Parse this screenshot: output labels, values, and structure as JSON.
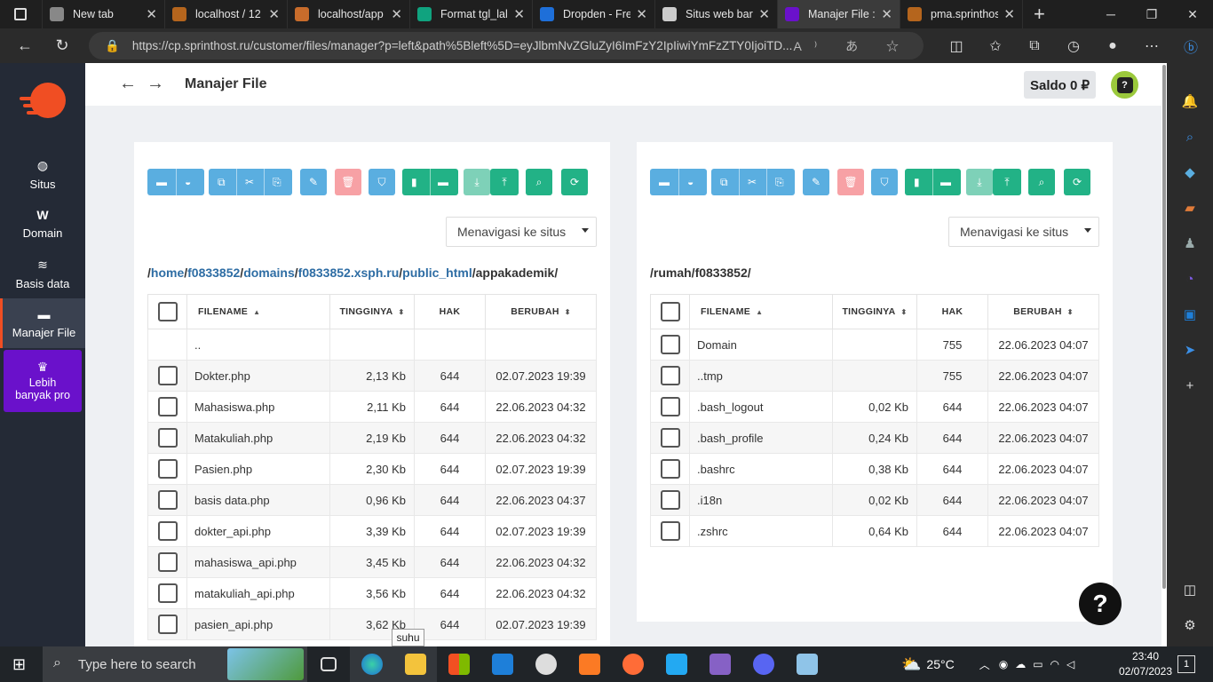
{
  "browser": {
    "tabs": [
      {
        "title": "New tab",
        "color": "#888"
      },
      {
        "title": "localhost / 12",
        "color": "#b5651d"
      },
      {
        "title": "localhost/app",
        "color": "#c86c2b"
      },
      {
        "title": "Format tgl_lal",
        "color": "#10a37f"
      },
      {
        "title": "Dropden - Fre",
        "color": "#1e6fd9"
      },
      {
        "title": "Situs web bar",
        "color": "#cccccc"
      },
      {
        "title": "Manajer File :",
        "color": "#6a11cb"
      },
      {
        "title": "pma.sprinthos",
        "color": "#b5651d"
      }
    ],
    "url": "https://cp.sprinthost.ru/customer/files/manager?p=left&path%5Bleft%5D=eyJlbmNvZGluZyI6ImFzY2IpIiwiYmFzZTY0IjoiTD..."
  },
  "sidebar": {
    "items": [
      {
        "label": "Situs",
        "icon": "globe-icon"
      },
      {
        "label": "Domain",
        "icon": "w-icon"
      },
      {
        "label": "Basis data",
        "icon": "database-icon"
      },
      {
        "label": "Manajer File",
        "icon": "folder-icon"
      }
    ],
    "pro_label": "Lebih banyak pro"
  },
  "header": {
    "title": "Manajer File",
    "saldo": "Saldo 0 ₽",
    "avatar_glyph": "?"
  },
  "left_panel": {
    "nav_select": "Menavigasi ke situs",
    "path_segments": [
      "/",
      "home",
      "/",
      "f0833852",
      "/",
      "domains",
      "/",
      "f0833852.xsph.ru",
      "/",
      "public_html",
      "/appakademik/"
    ],
    "columns": [
      "FILENAME",
      "TINGGINYA",
      "HAK",
      "BERUBAH"
    ],
    "rows": [
      {
        "name": "..",
        "size": "",
        "perm": "",
        "date": ""
      },
      {
        "name": "Dokter.php",
        "size": "2,13 Kb",
        "perm": "644",
        "date": "02.07.2023 19:39"
      },
      {
        "name": "Mahasiswa.php",
        "size": "2,11 Kb",
        "perm": "644",
        "date": "22.06.2023 04:32"
      },
      {
        "name": "Matakuliah.php",
        "size": "2,19 Kb",
        "perm": "644",
        "date": "22.06.2023 04:32"
      },
      {
        "name": "Pasien.php",
        "size": "2,30 Kb",
        "perm": "644",
        "date": "02.07.2023 19:39"
      },
      {
        "name": "basis data.php",
        "size": "0,96 Kb",
        "perm": "644",
        "date": "22.06.2023 04:37"
      },
      {
        "name": "dokter_api.php",
        "size": "3,39 Kb",
        "perm": "644",
        "date": "02.07.2023 19:39"
      },
      {
        "name": "mahasiswa_api.php",
        "size": "3,45 Kb",
        "perm": "644",
        "date": "22.06.2023 04:32"
      },
      {
        "name": "matakuliah_api.php",
        "size": "3,56 Kb",
        "perm": "644",
        "date": "22.06.2023 04:32"
      },
      {
        "name": "pasien_api.php",
        "size": "3,62 Kb",
        "perm": "644",
        "date": "02.07.2023 19:39"
      }
    ]
  },
  "right_panel": {
    "nav_select": "Menavigasi ke situs",
    "path": "/rumah/f0833852/",
    "columns": [
      "FILENAME",
      "TINGGINYA",
      "HAK",
      "BERUBAH"
    ],
    "rows": [
      {
        "name": "Domain",
        "size": "",
        "perm": "755",
        "date": "22.06.2023 04:07"
      },
      {
        "name": "..tmp",
        "size": "",
        "perm": "755",
        "date": "22.06.2023 04:07"
      },
      {
        "name": ".bash_logout",
        "size": "0,02 Kb",
        "perm": "644",
        "date": "22.06.2023 04:07"
      },
      {
        "name": ".bash_profile",
        "size": "0,24 Kb",
        "perm": "644",
        "date": "22.06.2023 04:07"
      },
      {
        "name": ".bashrc",
        "size": "0,38 Kb",
        "perm": "644",
        "date": "22.06.2023 04:07"
      },
      {
        "name": ".i18n",
        "size": "0,02 Kb",
        "perm": "644",
        "date": "22.06.2023 04:07"
      },
      {
        "name": ".zshrc",
        "size": "0,64 Kb",
        "perm": "644",
        "date": "22.06.2023 04:07"
      }
    ]
  },
  "tooltip": "suhu",
  "help_glyph": "?",
  "taskbar": {
    "search_placeholder": "Type here to search",
    "weather": "25°C",
    "time": "23:40",
    "date": "02/07/2023",
    "notif_count": "1"
  },
  "colors": {
    "sidebar_bg": "#242a36",
    "accent": "#f04e23",
    "pro": "#6a11cb",
    "toolbar_blue": "#5aaee0",
    "toolbar_green": "#22b286",
    "toolbar_red": "#f7a1a5",
    "link": "#2e6da4"
  }
}
